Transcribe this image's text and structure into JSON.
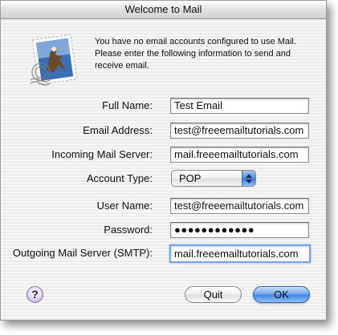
{
  "window": {
    "title": "Welcome to Mail"
  },
  "logo": {
    "icon": "mail-stamp-eagle-icon"
  },
  "intro": {
    "text": "You have no email accounts configured to use Mail. Please enter the following information to send and receive email."
  },
  "form": {
    "full_name": {
      "label": "Full Name:",
      "value": "Test Email"
    },
    "email_address": {
      "label": "Email Address:",
      "value": "test@freeemailtutorials.com"
    },
    "incoming_server": {
      "label": "Incoming Mail Server:",
      "value": "mail.freeemailtutorials.com"
    },
    "account_type": {
      "label": "Account Type:",
      "value": "POP",
      "options": [
        "POP"
      ]
    },
    "user_name": {
      "label": "User Name:",
      "value": "test@freeemailtutorials.com"
    },
    "password": {
      "label": "Password:",
      "value": "●●●●●●●●●●●●"
    },
    "outgoing_server": {
      "label": "Outgoing Mail Server (SMTP):",
      "value": "mail.freeemailtutorials.com"
    }
  },
  "buttons": {
    "help": "?",
    "quit": "Quit",
    "ok": "OK"
  },
  "colors": {
    "default_button": "#4a8de3",
    "focus_ring": "#7aa7e3",
    "popup_arrows": "#3f86e2"
  }
}
